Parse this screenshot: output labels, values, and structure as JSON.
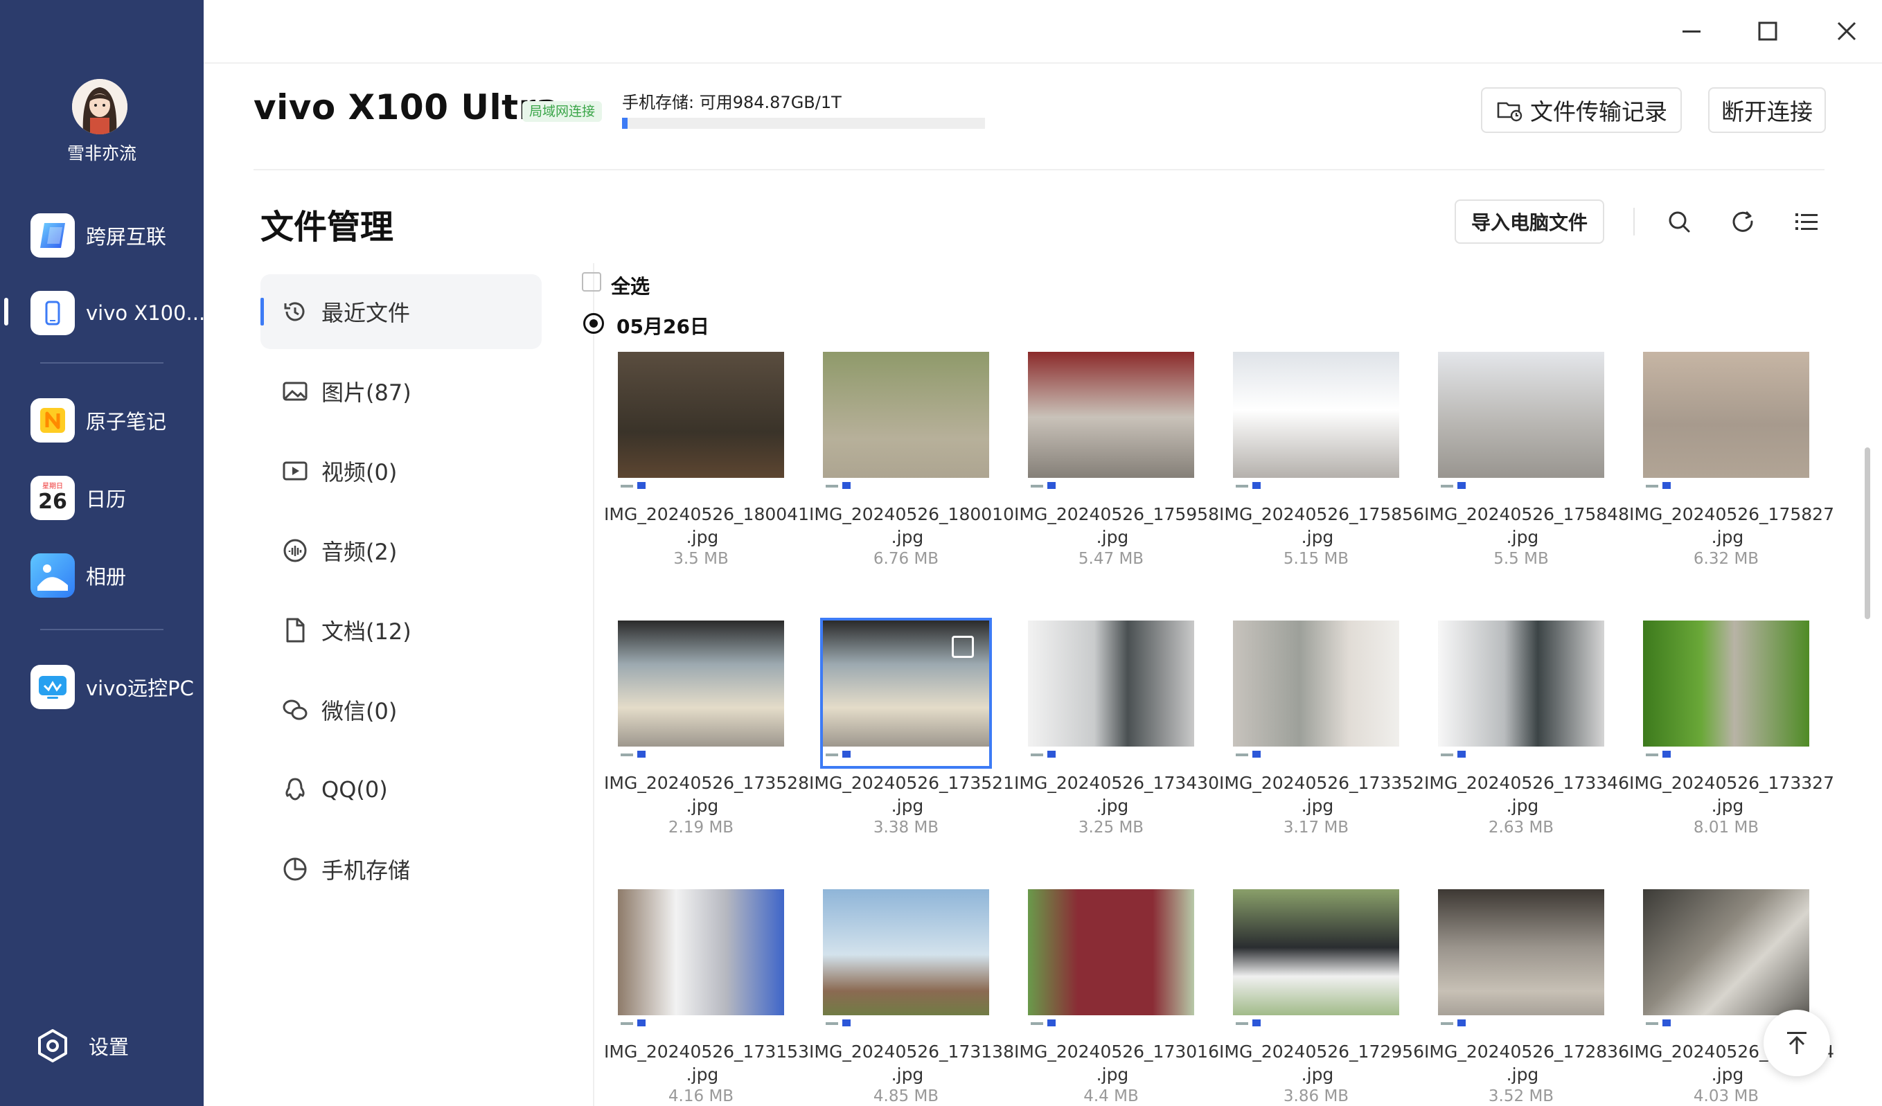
{
  "user": {
    "name": "雪非亦流"
  },
  "sidebar": {
    "items": [
      {
        "label": "跨屏互联",
        "icon": "cross-screen-icon"
      },
      {
        "label": "vivo X100...",
        "icon": "phone-icon"
      },
      {
        "label": "原子笔记",
        "icon": "notes-icon"
      },
      {
        "label": "日历",
        "icon": "calendar-icon",
        "icon_text": "26",
        "icon_caption": "星期日"
      },
      {
        "label": "相册",
        "icon": "album-icon"
      },
      {
        "label": "vivo远控PC",
        "icon": "remote-pc-icon"
      }
    ],
    "settings_label": "设置"
  },
  "header": {
    "device_name": "vivo X100 Ultra",
    "connection_badge": "局域网连接",
    "storage_text": "手机存储: 可用984.87GB/1T",
    "storage_used_fraction": 0.015,
    "transfer_log_label": "文件传输记录",
    "disconnect_label": "断开连接"
  },
  "file_manager": {
    "title": "文件管理",
    "import_label": "导入电脑文件",
    "categories": [
      {
        "label": "最近文件",
        "icon": "history-icon",
        "active": true
      },
      {
        "label": "图片(87)",
        "icon": "image-icon"
      },
      {
        "label": "视频(0)",
        "icon": "video-icon"
      },
      {
        "label": "音频(2)",
        "icon": "audio-icon"
      },
      {
        "label": "文档(12)",
        "icon": "document-icon"
      },
      {
        "label": "微信(0)",
        "icon": "wechat-icon"
      },
      {
        "label": "QQ(0)",
        "icon": "qq-icon"
      },
      {
        "label": "手机存储",
        "icon": "storage-pie-icon"
      }
    ],
    "select_all_label": "全选",
    "date_group": "05月26日",
    "files": [
      {
        "name": "IMG_20240526_180041.jpg",
        "size": "3.5 MB"
      },
      {
        "name": "IMG_20240526_180010.jpg",
        "size": "6.76 MB"
      },
      {
        "name": "IMG_20240526_175958.jpg",
        "size": "5.47 MB"
      },
      {
        "name": "IMG_20240526_175856.jpg",
        "size": "5.15 MB"
      },
      {
        "name": "IMG_20240526_175848.jpg",
        "size": "5.5 MB"
      },
      {
        "name": "IMG_20240526_175827.jpg",
        "size": "6.32 MB"
      },
      {
        "name": "IMG_20240526_173528.jpg",
        "size": "2.19 MB"
      },
      {
        "name": "IMG_20240526_173521.jpg",
        "size": "3.38 MB",
        "selected": true
      },
      {
        "name": "IMG_20240526_173430.jpg",
        "size": "3.25 MB"
      },
      {
        "name": "IMG_20240526_173352.jpg",
        "size": "3.17 MB"
      },
      {
        "name": "IMG_20240526_173346.jpg",
        "size": "2.63 MB"
      },
      {
        "name": "IMG_20240526_173327.jpg",
        "size": "8.01 MB"
      },
      {
        "name": "IMG_20240526_173153.jpg",
        "size": "4.16 MB"
      },
      {
        "name": "IMG_20240526_173138.jpg",
        "size": "4.85 MB"
      },
      {
        "name": "IMG_20240526_173016.jpg",
        "size": "4.4 MB"
      },
      {
        "name": "IMG_20240526_172956.jpg",
        "size": "3.86 MB"
      },
      {
        "name": "IMG_20240526_172836.jpg",
        "size": "3.52 MB"
      },
      {
        "name": "IMG_20240526_172824.jpg",
        "size": "4.03 MB"
      }
    ]
  },
  "colors": {
    "sidebar_bg": "#2c3c6c",
    "accent": "#3d7bf5",
    "badge_green": "#3aa548"
  }
}
